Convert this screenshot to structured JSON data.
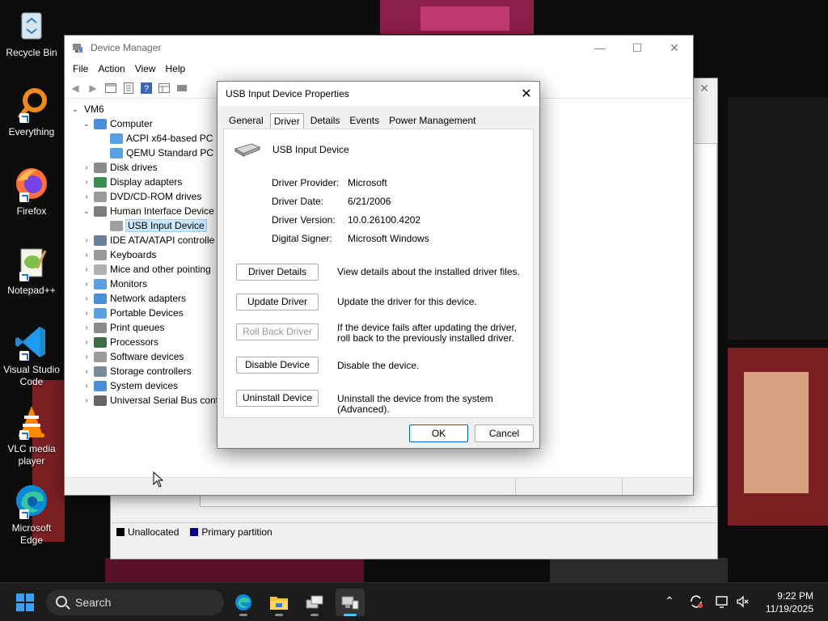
{
  "desktop": {
    "icons": [
      {
        "label": "Recycle Bin",
        "icon": "recycle-bin-icon"
      },
      {
        "label": "Everything",
        "icon": "everything-search-icon"
      },
      {
        "label": "Firefox",
        "icon": "firefox-icon"
      },
      {
        "label": "Notepad++",
        "icon": "notepadpp-icon"
      },
      {
        "label": "Visual Studio Code",
        "icon": "vscode-icon"
      },
      {
        "label": "VLC media player",
        "icon": "vlc-icon"
      },
      {
        "label": "Microsoft Edge",
        "icon": "edge-icon"
      }
    ]
  },
  "disk_mgmt": {
    "legend": [
      {
        "label": "Unallocated",
        "color": "#000000"
      },
      {
        "label": "Primary partition",
        "color": "#000080"
      }
    ]
  },
  "device_manager": {
    "title": "Device Manager",
    "menu": [
      "File",
      "Action",
      "View",
      "Help"
    ],
    "tree": {
      "root": "VM6",
      "items": [
        {
          "label": "Computer",
          "level": 1,
          "expanded": true,
          "icon": "computer-icon"
        },
        {
          "label": "ACPI x64-based PC",
          "level": 2,
          "icon": "monitor-icon"
        },
        {
          "label": "QEMU Standard PC (",
          "level": 2,
          "icon": "monitor-icon"
        },
        {
          "label": "Disk drives",
          "level": 1,
          "expanded": false,
          "icon": "disk-drive-icon"
        },
        {
          "label": "Display adapters",
          "level": 1,
          "expanded": false,
          "icon": "display-adapter-icon"
        },
        {
          "label": "DVD/CD-ROM drives",
          "level": 1,
          "expanded": false,
          "icon": "dvd-drive-icon"
        },
        {
          "label": "Human Interface Device",
          "level": 1,
          "expanded": true,
          "icon": "hid-icon"
        },
        {
          "label": "USB Input Device",
          "level": 2,
          "selected": true,
          "icon": "usb-input-icon"
        },
        {
          "label": "IDE ATA/ATAPI controlle",
          "level": 1,
          "expanded": false,
          "icon": "ide-controller-icon"
        },
        {
          "label": "Keyboards",
          "level": 1,
          "expanded": false,
          "icon": "keyboard-icon"
        },
        {
          "label": "Mice and other pointing",
          "level": 1,
          "expanded": false,
          "icon": "mouse-icon"
        },
        {
          "label": "Monitors",
          "level": 1,
          "expanded": false,
          "icon": "monitor-icon"
        },
        {
          "label": "Network adapters",
          "level": 1,
          "expanded": false,
          "icon": "network-adapter-icon"
        },
        {
          "label": "Portable Devices",
          "level": 1,
          "expanded": false,
          "icon": "portable-device-icon"
        },
        {
          "label": "Print queues",
          "level": 1,
          "expanded": false,
          "icon": "printer-icon"
        },
        {
          "label": "Processors",
          "level": 1,
          "expanded": false,
          "icon": "processor-icon"
        },
        {
          "label": "Software devices",
          "level": 1,
          "expanded": false,
          "icon": "software-device-icon"
        },
        {
          "label": "Storage controllers",
          "level": 1,
          "expanded": false,
          "icon": "storage-controller-icon"
        },
        {
          "label": "System devices",
          "level": 1,
          "expanded": false,
          "icon": "system-device-icon"
        },
        {
          "label": "Universal Serial Bus cont",
          "level": 1,
          "expanded": false,
          "icon": "usb-controller-icon"
        }
      ]
    }
  },
  "dialog": {
    "title": "USB Input Device Properties",
    "tabs": [
      "General",
      "Driver",
      "Details",
      "Events",
      "Power Management"
    ],
    "active_tab": "Driver",
    "device_name": "USB Input Device",
    "info": [
      {
        "key": "Driver Provider:",
        "value": "Microsoft"
      },
      {
        "key": "Driver Date:",
        "value": "6/21/2006"
      },
      {
        "key": "Driver Version:",
        "value": "10.0.26100.4202"
      },
      {
        "key": "Digital Signer:",
        "value": "Microsoft Windows"
      }
    ],
    "actions": [
      {
        "label": "Driver Details",
        "desc": "View details about the installed driver files.",
        "enabled": true
      },
      {
        "label": "Update Driver",
        "desc": "Update the driver for this device.",
        "enabled": true
      },
      {
        "label": "Roll Back Driver",
        "desc": "If the device fails after updating the driver, roll back to the previously installed driver.",
        "enabled": false
      },
      {
        "label": "Disable Device",
        "desc": "Disable the device.",
        "enabled": true
      },
      {
        "label": "Uninstall Device",
        "desc": "Uninstall the device from the system (Advanced).",
        "enabled": true
      }
    ],
    "ok": "OK",
    "cancel": "Cancel"
  },
  "taskbar": {
    "search_placeholder": "Search",
    "apps": [
      "edge-icon",
      "file-explorer-icon",
      "network-app-icon",
      "device-manager-icon"
    ],
    "time": "9:22 PM",
    "date": "11/19/2025"
  },
  "colors": {
    "accent": "#0067c0",
    "taskbar": "#1c1c1c",
    "selection": "#cce8ff"
  }
}
